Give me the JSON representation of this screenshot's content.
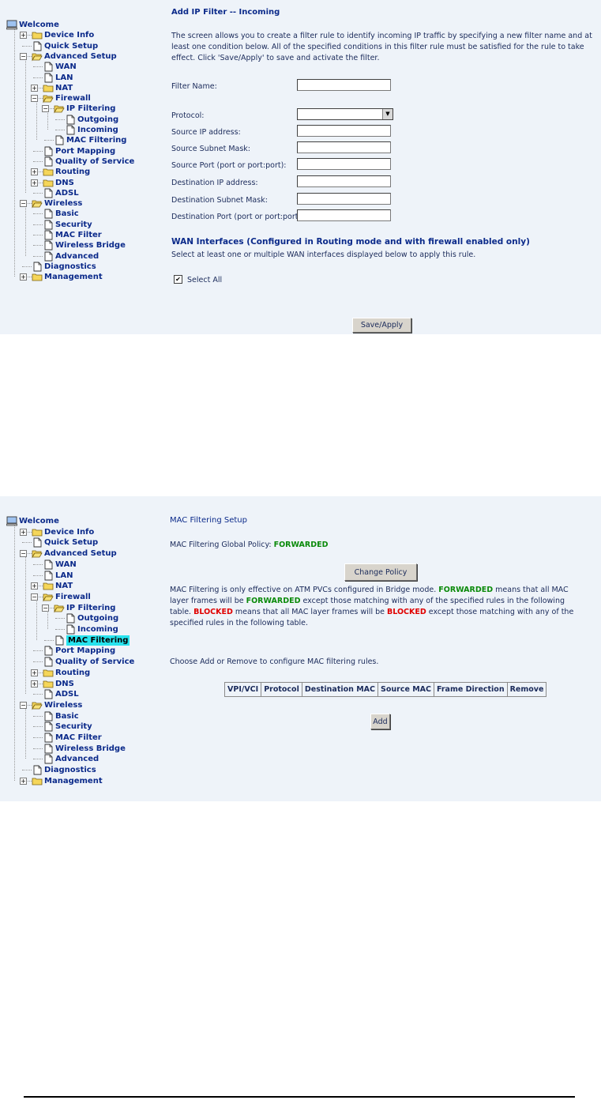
{
  "tree1": {
    "items": [
      "Welcome",
      "Device Info",
      "Quick Setup",
      "Advanced Setup",
      "WAN",
      "LAN",
      "NAT",
      "Firewall",
      "IP Filtering",
      "Outgoing",
      "Incoming",
      "MAC Filtering",
      "Port Mapping",
      "Quality of Service",
      "Routing",
      "DNS",
      "ADSL",
      "Wireless",
      "Basic",
      "Security",
      "MAC Filter",
      "Wireless Bridge",
      "Advanced",
      "Diagnostics",
      "Management"
    ]
  },
  "tree2": {
    "items": [
      "Welcome",
      "Device Info",
      "Quick Setup",
      "Advanced Setup",
      "WAN",
      "LAN",
      "NAT",
      "Firewall",
      "IP Filtering",
      "Outgoing",
      "Incoming",
      "MAC Filtering",
      "Port Mapping",
      "Quality of Service",
      "Routing",
      "DNS",
      "ADSL",
      "Wireless",
      "Basic",
      "Security",
      "MAC Filter",
      "Wireless Bridge",
      "Advanced",
      "Diagnostics",
      "Management"
    ]
  },
  "ipfilter": {
    "title": "Add IP Filter -- Incoming",
    "description": "The screen allows you to create a filter rule to identify incoming IP traffic by specifying a new filter name and at least one condition below. All of the specified conditions in this filter rule must be satisfied for the rule to take effect. Click 'Save/Apply' to save and activate the filter.",
    "filter_name_label": "Filter Name:",
    "filter_name_value": "",
    "protocol_label": "Protocol:",
    "protocol_value": "",
    "src_ip_label": "Source IP address:",
    "src_mask_label": "Source Subnet Mask:",
    "src_port_label": "Source Port (port or port:port):",
    "dst_ip_label": "Destination IP address:",
    "dst_mask_label": "Destination Subnet Mask:",
    "dst_port_label": "Destination Port (port or port:port):",
    "wan_title": "WAN Interfaces (Configured in Routing mode and with firewall enabled only)",
    "wan_desc": "Select at least one or multiple WAN interfaces displayed below to apply this rule.",
    "select_all_label": "Select All",
    "select_all_checked": true,
    "save_button": "Save/Apply"
  },
  "macfilter": {
    "title": "MAC Filtering Setup",
    "policy_label": "MAC Filtering Global Policy: ",
    "policy_value": "FORWARDED",
    "change_policy_button": "Change Policy",
    "desc_part1": "MAC Filtering is only effective on ATM PVCs configured in Bridge mode. ",
    "desc_fw1": "FORWARDED",
    "desc_part2": " means that all MAC layer frames will be ",
    "desc_fw2": "FORWARDED",
    "desc_part3": " except those matching with any of the specified rules in the following table. ",
    "desc_bl1": "BLOCKED",
    "desc_part4": " means that all MAC layer frames will be ",
    "desc_bl2": "BLOCKED",
    "desc_part5": " except those matching with any of the specified rules in the following table.",
    "choose_text": "Choose Add or Remove to configure MAC filtering rules.",
    "table_headers": [
      "VPI/VCI",
      "Protocol",
      "Destination MAC",
      "Source MAC",
      "Frame Direction",
      "Remove"
    ],
    "add_button": "Add"
  },
  "colors": {
    "panel_bg": "#eef3f9",
    "nav_text": "#0b2a8a",
    "forwarded": "#0a8a0a",
    "blocked": "#e00000",
    "selected_bg": "#27e3ee"
  }
}
